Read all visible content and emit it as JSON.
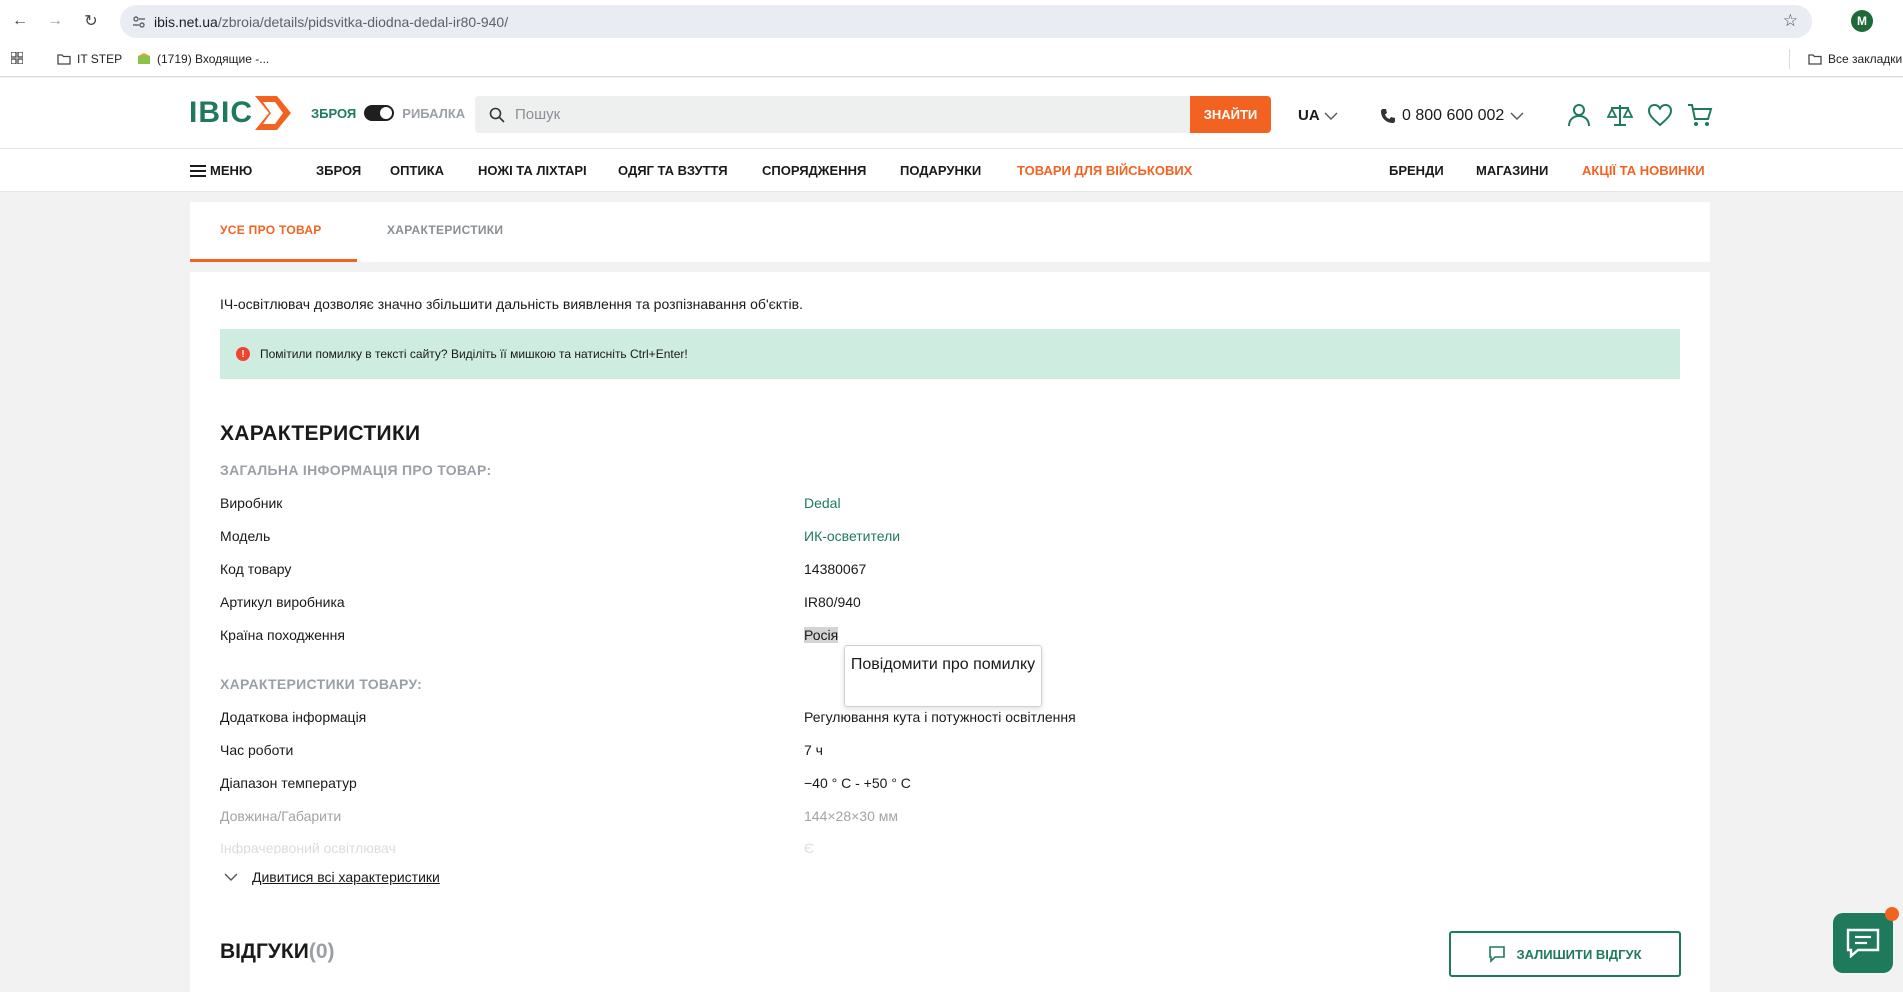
{
  "browser": {
    "url_host": "ibis.net.ua",
    "url_path": "/zbroia/details/pidsvitka-diodna-dedal-ir80-940/",
    "profile_initial": "M",
    "bookmarks": [
      {
        "label": "IT STEP"
      },
      {
        "label": "(1719) Входящие -..."
      }
    ],
    "all_bookmarks_label": "Все закладки"
  },
  "header": {
    "logo_text": "IBIC",
    "toggle_left": "ЗБРОЯ",
    "toggle_right": "РИБАЛКА",
    "search_placeholder": "Пошук",
    "search_button": "ЗНАЙТИ",
    "lang": "UA",
    "phone": "0 800 600 002"
  },
  "menu": {
    "menu_label": "МЕНЮ",
    "items": [
      "ЗБРОЯ",
      "ОПТИКА",
      "НОЖІ ТА ЛІХТАРІ",
      "ОДЯГ ТА ВЗУТТЯ",
      "СПОРЯДЖЕННЯ",
      "ПОДАРУНКИ",
      "ТОВАРИ ДЛЯ ВІЙСЬКОВИХ",
      "БРЕНДИ",
      "МАГАЗИНИ",
      "АКЦІЇ ТА НОВИНКИ"
    ]
  },
  "tabs": {
    "all": "УСЕ ПРО ТОВАР",
    "specs": "ХАРАКТЕРИСТИКИ"
  },
  "content": {
    "intro": "ІЧ-освітлювач дозволяє значно збільшити дальність виявлення та розпізнавання об'єктів.",
    "notice": "Помітили помилку в тексті сайту? Виділіть її мишкою та натисніть Ctrl+Enter!",
    "section_title": "ХАРАКТЕРИСТИКИ",
    "group1_title": "ЗАГАЛЬНА ІНФОРМАЦІЯ ПРО ТОВАР:",
    "group1": [
      {
        "k": "Виробник",
        "v": "Dedal"
      },
      {
        "k": "Модель",
        "v": "ИК-осветители"
      },
      {
        "k": "Код товару",
        "v": "14380067"
      },
      {
        "k": "Артикул виробника",
        "v": "IR80/940"
      },
      {
        "k": "Країна походження",
        "v": "Росія"
      }
    ],
    "group2_title": "ХАРАКТЕРИСТИКИ ТОВАРУ:",
    "group2": [
      {
        "k": "Додаткова інформація",
        "v": "Регулювання кута і потужності освітлення"
      },
      {
        "k": "Час роботи",
        "v": "7 ч"
      },
      {
        "k": "Діапазон температур",
        "v": "−40 ° С - +50 ° С"
      },
      {
        "k": "Довжина/Габарити",
        "v": "144×28×30 мм"
      },
      {
        "k": "Інфрачервоний освітлювач",
        "v": "Є"
      }
    ],
    "see_all": "Дивитися всі характеристики",
    "tooltip": "Повідомити про помилку",
    "reviews_label": "ВІДГУКИ",
    "reviews_count": "(0)",
    "review_button": "ЗАЛИШИТИ ВІДГУК"
  }
}
